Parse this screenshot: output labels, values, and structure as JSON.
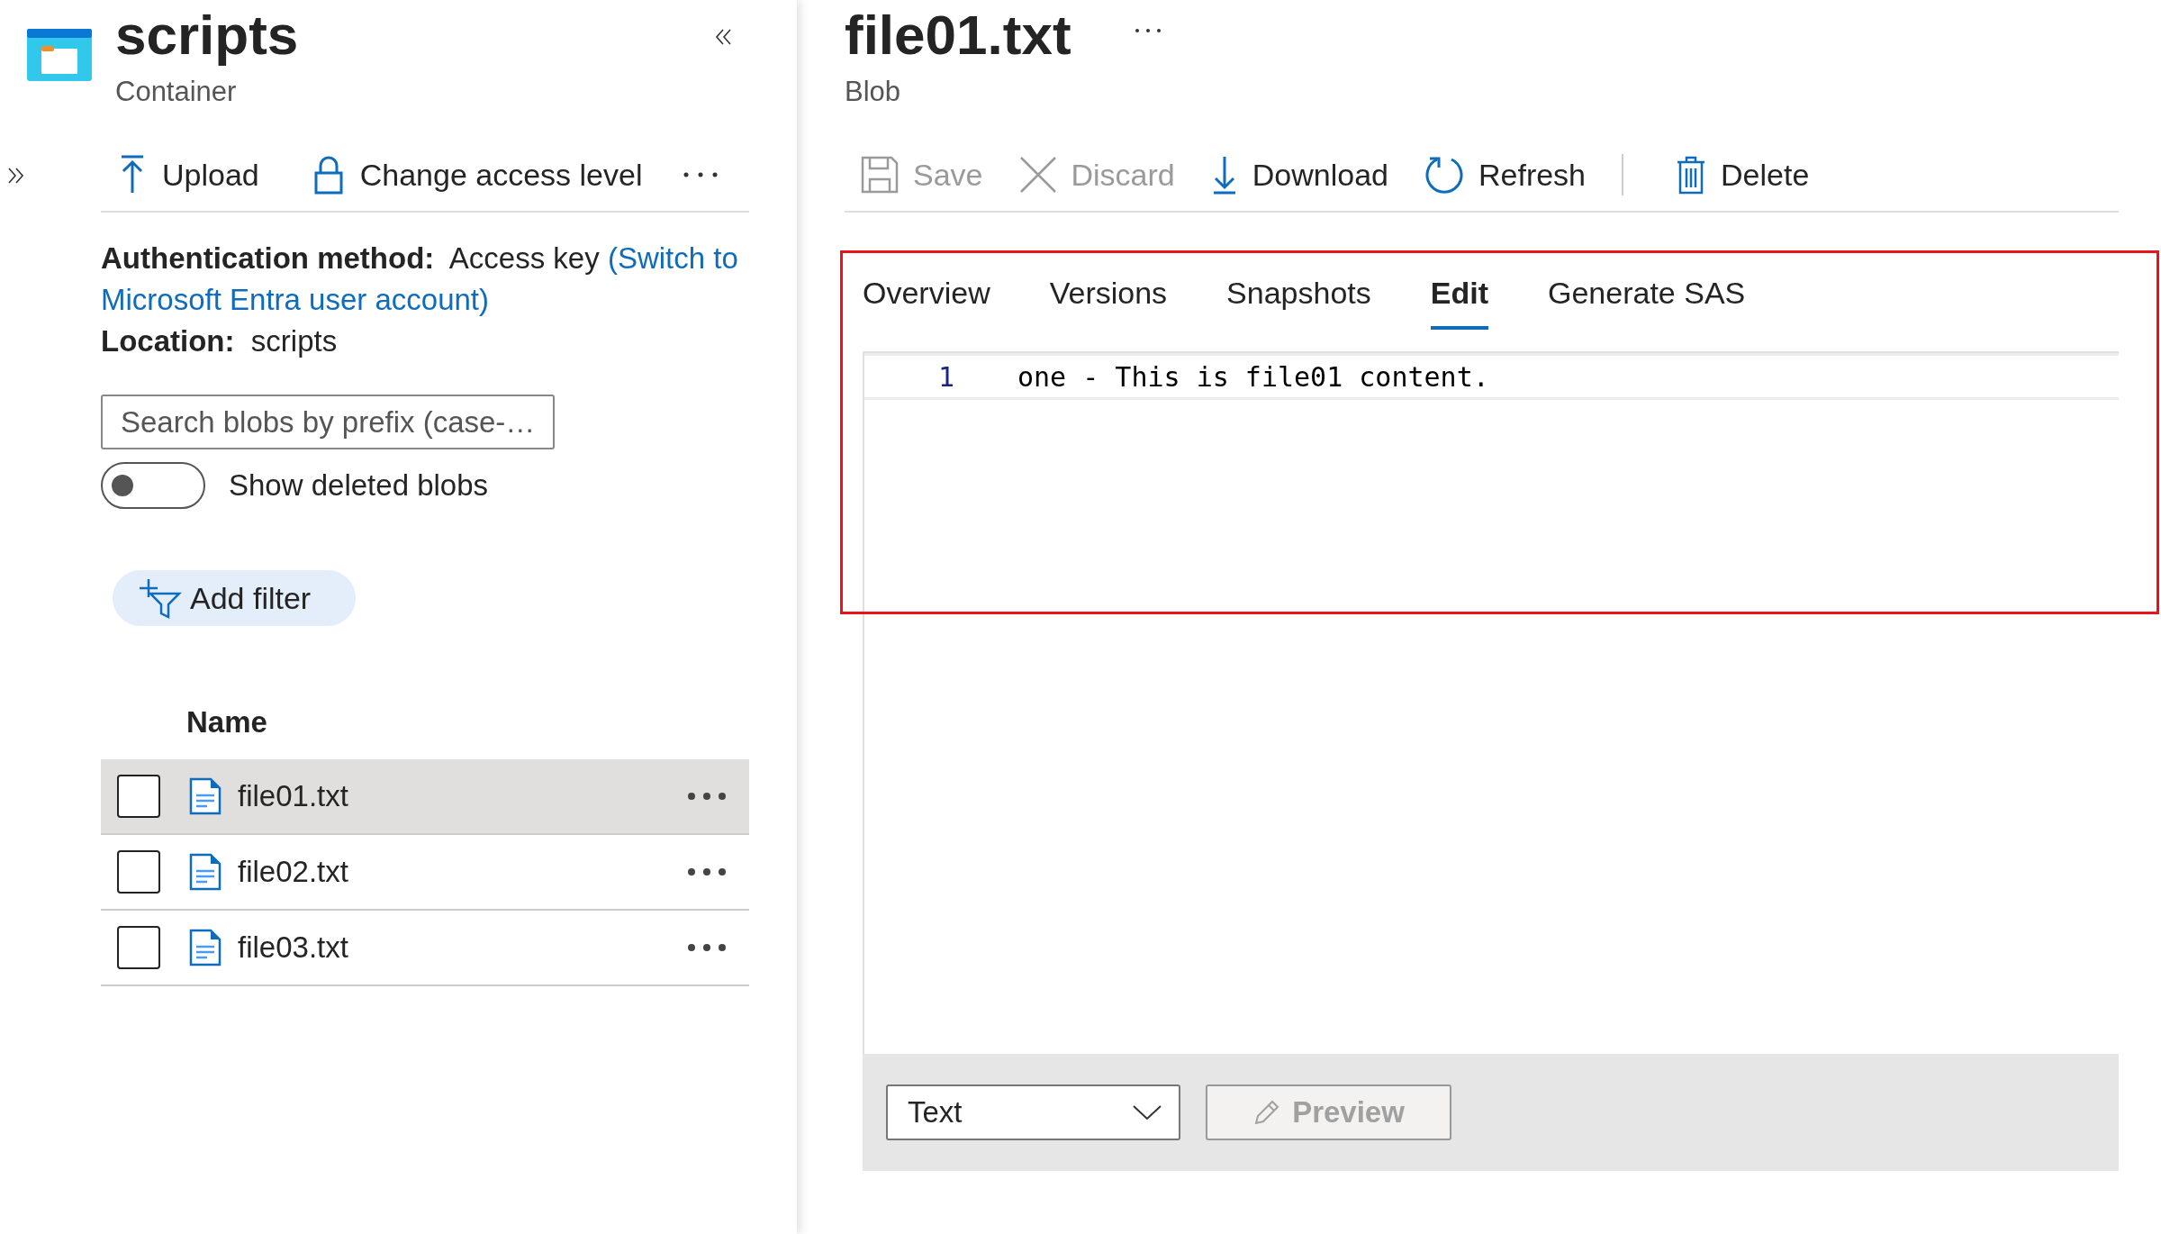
{
  "container": {
    "title": "scripts",
    "subtitle": "Container"
  },
  "left_toolbar": [
    {
      "label": "Upload",
      "kind": "upload"
    },
    {
      "label": "Change access level",
      "kind": "lock"
    }
  ],
  "auth": {
    "label": "Authentication method:",
    "value": "Access key",
    "link": [
      "(Switch to",
      "Microsoft Entra user account)"
    ]
  },
  "location": {
    "label": "Location:",
    "value": "scripts"
  },
  "search": {
    "placeholder": "Search blobs by prefix (case-…"
  },
  "toggle": {
    "label": "Show deleted blobs",
    "on": false
  },
  "add_filter": "Add filter",
  "table": {
    "columns": [
      "Name"
    ],
    "rows": [
      {
        "name": "file01.txt",
        "selected": true,
        "checked": false
      },
      {
        "name": "file02.txt",
        "selected": false,
        "checked": false
      },
      {
        "name": "file03.txt",
        "selected": false,
        "checked": false
      }
    ]
  },
  "blob": {
    "title": "file01.txt",
    "subtitle": "Blob"
  },
  "toolbar": [
    {
      "label": "Save",
      "kind": "save",
      "disabled": true
    },
    {
      "label": "Discard",
      "kind": "discard",
      "disabled": true
    },
    {
      "label": "Download",
      "kind": "download",
      "disabled": false
    },
    {
      "label": "Refresh",
      "kind": "refresh",
      "disabled": false
    },
    {
      "label": "Delete",
      "kind": "delete",
      "disabled": false
    }
  ],
  "tabs": [
    {
      "label": "Overview",
      "selected": false
    },
    {
      "label": "Versions",
      "selected": false
    },
    {
      "label": "Snapshots",
      "selected": false
    },
    {
      "label": "Edit",
      "selected": true
    },
    {
      "label": "Generate SAS",
      "selected": false
    }
  ],
  "editor": {
    "lines": [
      {
        "number": "1",
        "text": "one - This is file01 content."
      }
    ]
  },
  "footer": {
    "language": "Text",
    "preview": {
      "label": "Preview",
      "disabled": true
    }
  }
}
